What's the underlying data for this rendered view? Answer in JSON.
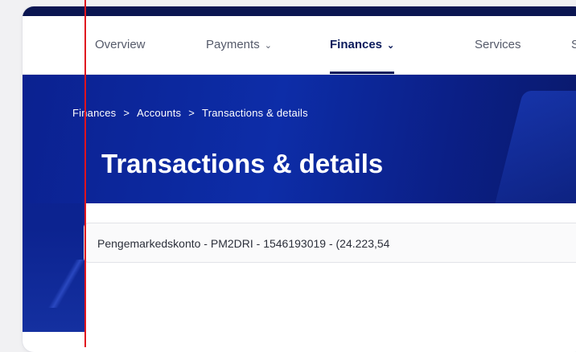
{
  "nav": {
    "items": [
      {
        "label": "Overview",
        "has_dropdown": false,
        "active": false
      },
      {
        "label": "Payments",
        "has_dropdown": true,
        "active": false
      },
      {
        "label": "Finances",
        "has_dropdown": true,
        "active": true
      },
      {
        "label": "Services",
        "has_dropdown": false,
        "active": false
      },
      {
        "label": "S",
        "has_dropdown": false,
        "active": false
      }
    ]
  },
  "breadcrumb": {
    "items": [
      "Finances",
      "Accounts",
      "Transactions & details"
    ],
    "separator": ">"
  },
  "page": {
    "title": "Transactions & details"
  },
  "account_select": {
    "value": "Pengemarkedskonto - PM2DRI - 1546193019 - (24.223,54"
  },
  "colors": {
    "brand_dark": "#0a1551",
    "hero_blue": "#0d2da8",
    "marker_red": "#e0141e"
  }
}
